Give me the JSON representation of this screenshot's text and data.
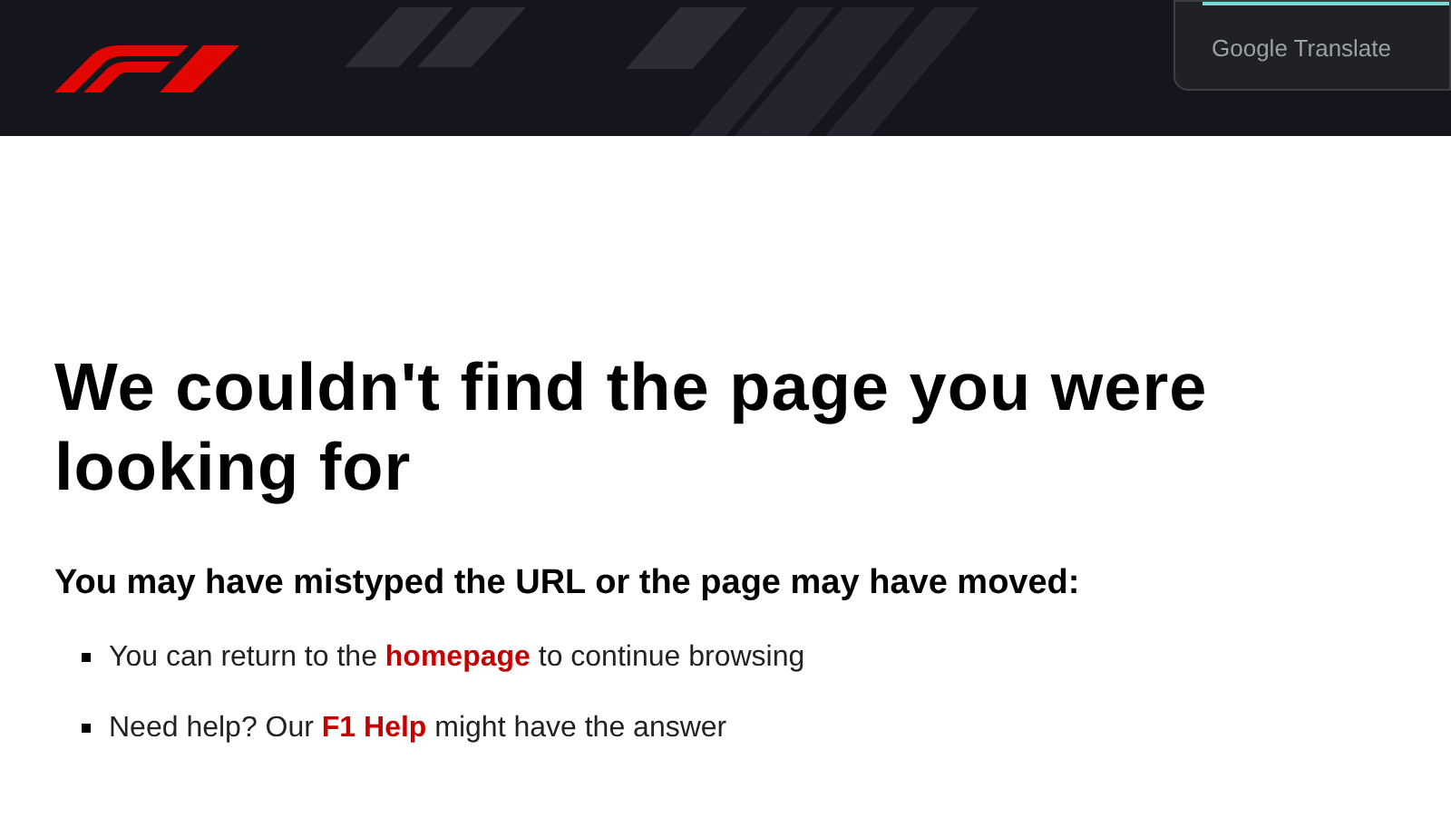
{
  "header": {
    "translate_popup": {
      "label": "Google Translate"
    }
  },
  "heading": "We couldn't find the page you were looking for",
  "subheading": "You may have mistyped the URL or the page may have moved:",
  "items": [
    {
      "before": "You can return to the ",
      "link": "homepage",
      "after": " to continue browsing"
    },
    {
      "before": "Need help? Our ",
      "link": "F1 Help",
      "after": " might have the answer"
    }
  ]
}
